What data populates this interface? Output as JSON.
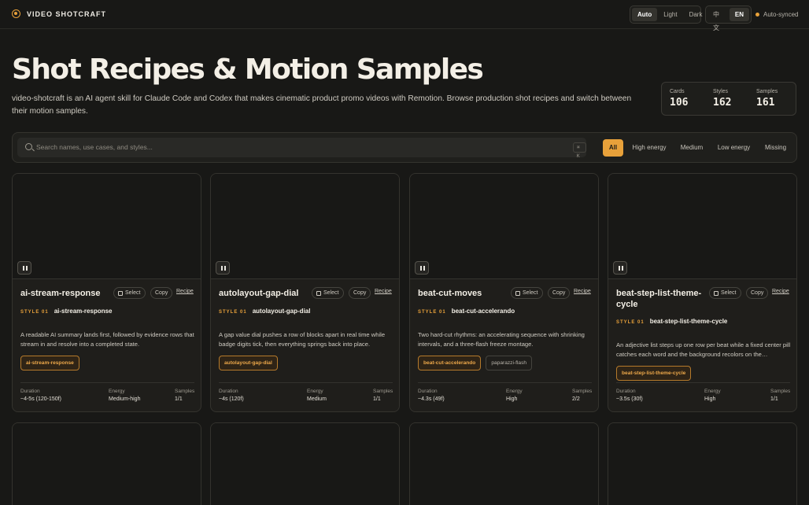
{
  "header": {
    "brand": "VIDEO SHOTCRAFT",
    "theme_options": [
      "Auto",
      "Light",
      "Dark"
    ],
    "theme_selected": "Auto",
    "lang_options": [
      "中文",
      "EN"
    ],
    "lang_selected": "EN",
    "sync_status": "Auto-synced"
  },
  "hero": {
    "title": "Shot Recipes & Motion Samples",
    "description": "video-shotcraft is an AI agent skill for Claude Code and Codex that makes cinematic product promo videos with Remotion. Browse production shot recipes and switch between their motion samples."
  },
  "stats": [
    {
      "label": "Cards",
      "value": "106"
    },
    {
      "label": "Styles",
      "value": "162"
    },
    {
      "label": "Samples",
      "value": "161"
    }
  ],
  "search": {
    "placeholder": "Search names, use cases, and styles...",
    "shortcut": "⌘ K"
  },
  "filters": [
    "All",
    "High energy",
    "Medium",
    "Low energy",
    "Missing"
  ],
  "filter_selected": "All",
  "card_actions": {
    "select": "Select",
    "copy": "Copy",
    "recipe": "Recipe"
  },
  "meta_labels": {
    "duration": "Duration",
    "energy": "Energy",
    "samples": "Samples"
  },
  "cards": [
    {
      "title": "ai-stream-response",
      "style_tag": "STYLE 01",
      "style_name": "ai-stream-response",
      "description": "A readable AI summary lands first, followed by evidence rows that stream in and resolve into a completed state.",
      "chips": [
        "ai-stream-response"
      ],
      "duration": "~4-5s (120-150f)",
      "energy": "Medium-high",
      "samples": "1/1"
    },
    {
      "title": "autolayout-gap-dial",
      "style_tag": "STYLE 01",
      "style_name": "autolayout-gap-dial",
      "description": "A gap value dial pushes a row of blocks apart in real time while badge digits tick, then everything springs back into place.",
      "chips": [
        "autolayout-gap-dial"
      ],
      "duration": "~4s (120f)",
      "energy": "Medium",
      "samples": "1/1"
    },
    {
      "title": "beat-cut-moves",
      "style_tag": "STYLE 01",
      "style_name": "beat-cut-accelerando",
      "description": "Two hard-cut rhythms: an accelerating sequence with shrinking intervals, and a three-flash freeze montage.",
      "chips": [
        "beat-cut-accelerando",
        "paparazzi-flash"
      ],
      "duration": "~4.3s (49f)",
      "energy": "High",
      "samples": "2/2"
    },
    {
      "title": "beat-step-list-theme-cycle",
      "style_tag": "STYLE 01",
      "style_name": "beat-step-list-theme-cycle",
      "description": "An adjective list steps up one row per beat while a fixed center pill catches each word and the background recolors on the…",
      "chips": [
        "beat-step-list-theme-cycle"
      ],
      "duration": "~3.5s (30f)",
      "energy": "High",
      "samples": "1/1"
    }
  ]
}
